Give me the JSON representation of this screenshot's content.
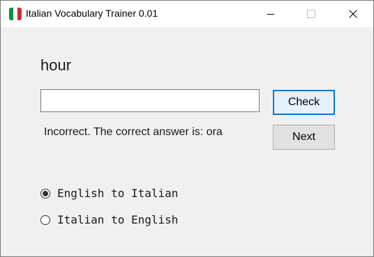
{
  "window": {
    "title": "Italian Vocabulary Trainer 0.01",
    "icon": "italian-flag-icon",
    "flag_colors": [
      "#009246",
      "#ffffff",
      "#ce2b37"
    ]
  },
  "quiz": {
    "word": "hour",
    "answer_value": "",
    "feedback": "Incorrect. The correct answer is: ora"
  },
  "buttons": {
    "check_label": "Check",
    "next_label": "Next"
  },
  "modes": [
    {
      "label": "English to Italian",
      "selected": true
    },
    {
      "label": "Italian to English",
      "selected": false
    }
  ],
  "colors": {
    "focus_accent": "#0078d7",
    "window_background": "#f0f0f0"
  }
}
